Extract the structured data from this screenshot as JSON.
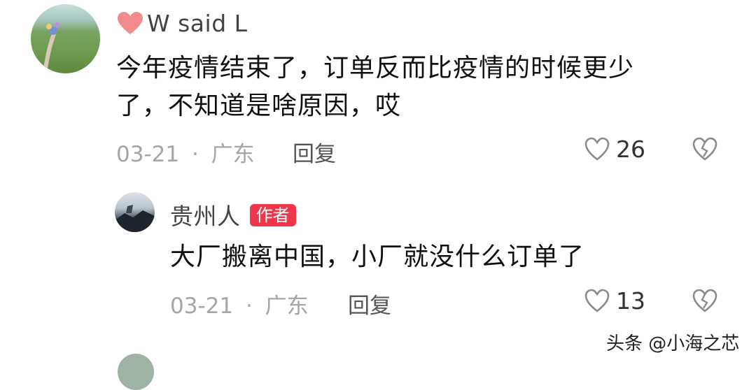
{
  "comment1": {
    "author": "W said L",
    "text_line1": "今年疫情结束了，订单反而比疫情的时候更少",
    "text_line2": "了，不知道是啥原因，哎",
    "date": "03-21",
    "separator": "·",
    "location": "广东",
    "reply_label": "回复",
    "like_count": "26"
  },
  "reply1": {
    "author": "贵州人",
    "author_tag": "作者",
    "text": "大厂搬离中国，小厂就没什么订单了",
    "date": "03-21",
    "separator": "·",
    "location": "广东",
    "reply_label": "回复",
    "like_count": "13"
  },
  "watermark": "头条 @小海之芯",
  "icons": {
    "name_prefix": "heart-icon",
    "like": "heart-outline-icon",
    "dislike": "broken-heart-icon"
  },
  "colors": {
    "author_tag": "#f0364b",
    "name_heart": "#f28b8b",
    "meta_gray": "#a5a5a5"
  }
}
